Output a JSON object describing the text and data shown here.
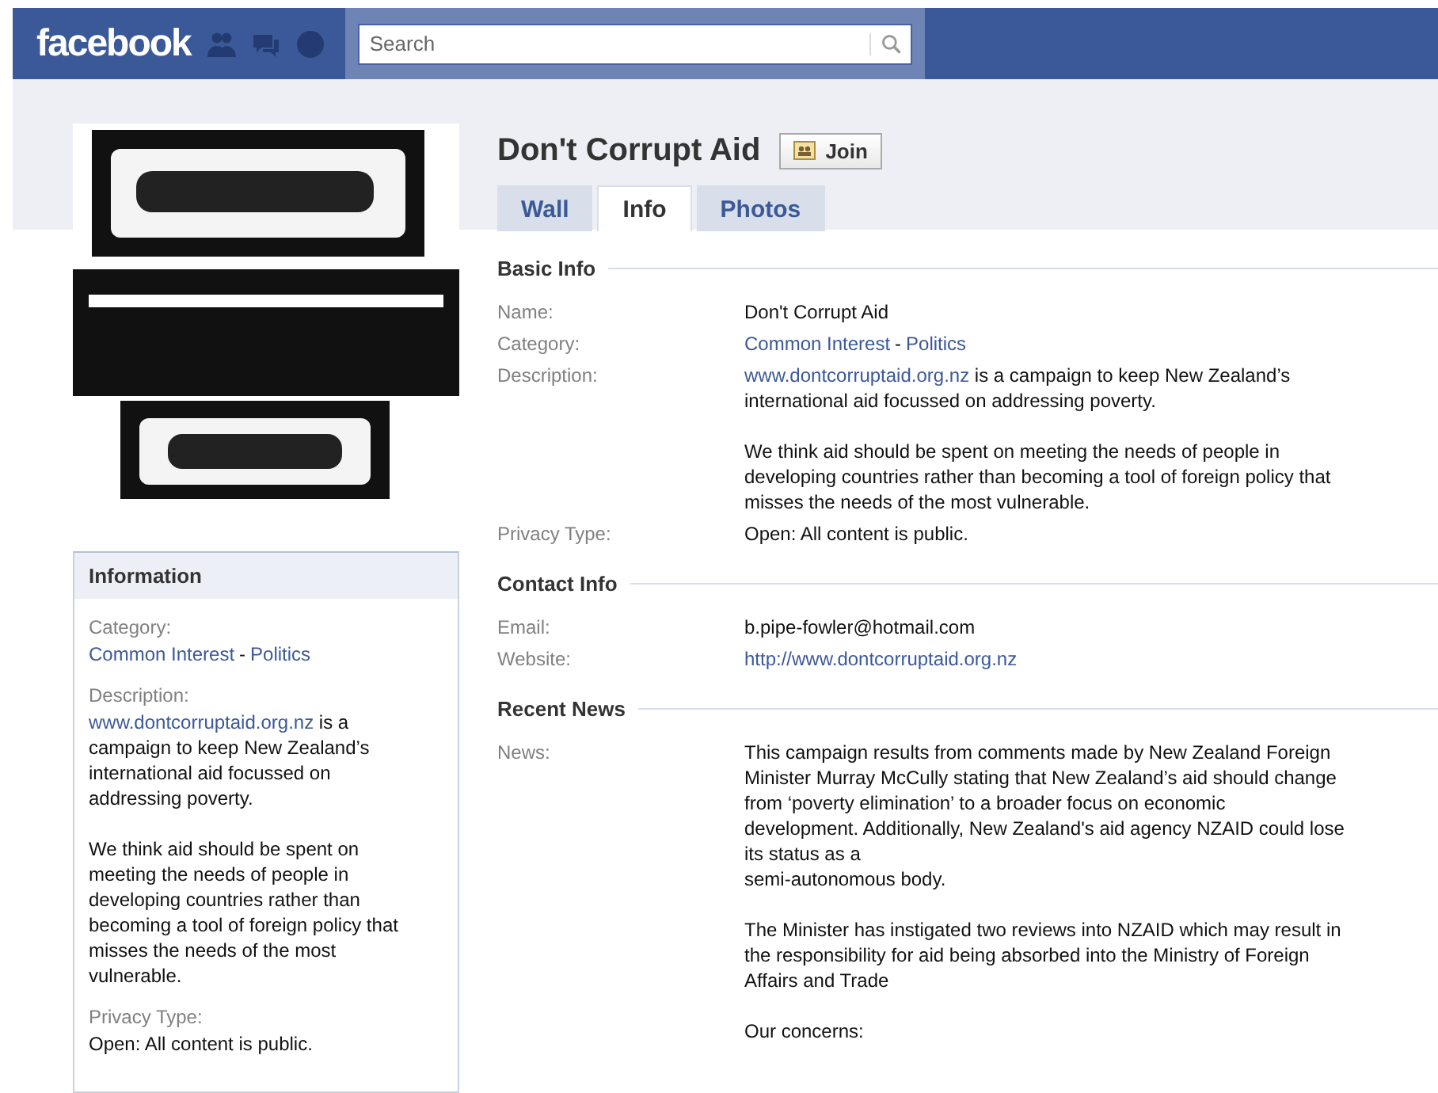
{
  "header": {
    "logo": "facebook",
    "search": {
      "placeholder": "Search"
    }
  },
  "page": {
    "title": "Don't Corrupt Aid",
    "join_button": "Join"
  },
  "tabs": [
    {
      "label": "Wall",
      "selected": false
    },
    {
      "label": "Info",
      "selected": true
    },
    {
      "label": "Photos",
      "selected": false
    }
  ],
  "sidebar": {
    "heading": "Information",
    "rows": [
      {
        "kind": "category",
        "label": "Category:",
        "parent": "Common Interest",
        "separator": "-",
        "child": "Politics"
      },
      {
        "kind": "description",
        "label": "Description:",
        "link": "www.dontcorruptaid.org.nz",
        "text": " is a\ncampaign to keep New Zealand’s\ninternational aid focussed on\naddressing poverty.",
        "paragraphs": [
          "We think aid should be spent on\nmeeting the needs of people in\ndeveloping countries rather than\nbecoming a tool of foreign policy that\nmisses the needs of the most\nvulnerable."
        ]
      },
      {
        "kind": "text",
        "label": "Privacy Type:",
        "value": "Open: All content is public."
      }
    ]
  },
  "sections": [
    {
      "heading": "Basic Info",
      "rows": [
        {
          "kind": "text",
          "label": "Name:",
          "value": "Don't Corrupt Aid"
        },
        {
          "kind": "category",
          "label": "Category:",
          "parent": "Common Interest",
          "separator": "-",
          "child": "Politics"
        },
        {
          "kind": "description",
          "label": "Description:",
          "link": "www.dontcorruptaid.org.nz",
          "text": " is a campaign to keep New Zealand’s\ninternational aid focussed on addressing poverty.",
          "paragraphs": [
            "We think aid should be spent on meeting the needs of people in\ndeveloping countries rather than becoming a tool of foreign policy that\nmisses the needs of the most vulnerable."
          ]
        },
        {
          "kind": "text",
          "label": "Privacy Type:",
          "value": "Open: All content is public."
        }
      ]
    },
    {
      "heading": "Contact Info",
      "rows": [
        {
          "kind": "text",
          "label": "Email:",
          "value": "b.pipe-fowler@hotmail.com"
        },
        {
          "kind": "link",
          "label": "Website:",
          "value": "http://www.dontcorruptaid.org.nz"
        }
      ]
    },
    {
      "heading": "Recent News",
      "rows": [
        {
          "kind": "paragraphs",
          "label": "News:",
          "paragraphs": [
            "This campaign results from comments made by New Zealand Foreign\nMinister Murray McCully stating that New Zealand’s aid should change\nfrom ‘poverty elimination’ to a broader focus on economic\ndevelopment. Additionally, New Zealand's aid agency NZAID could lose\nits status as a\nsemi-autonomous body.",
            "The Minister has instigated two reviews into NZAID which may result in\nthe responsibility for aid being absorbed into the Ministry of Foreign\nAffairs and Trade",
            "Our concerns:"
          ]
        }
      ]
    }
  ]
}
